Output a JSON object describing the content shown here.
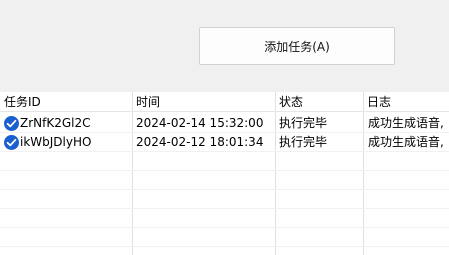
{
  "toolbar": {
    "add_task_label": "添加任务(A)"
  },
  "table": {
    "columns": [
      "任务ID",
      "时间",
      "状态",
      "日志"
    ],
    "rows": [
      {
        "id": "ZrNfK2Gl2C",
        "time": "2024-02-14 15:32:00",
        "status": "执行完毕",
        "log": "成功生成语音,"
      },
      {
        "id": "ikWbJDlyHO",
        "time": "2024-02-12 18:01:34",
        "status": "执行完毕",
        "log": "成功生成语音,"
      }
    ]
  },
  "colors": {
    "toolbar_bg": "#f0f0f0",
    "accent": "#1a5fd0"
  }
}
